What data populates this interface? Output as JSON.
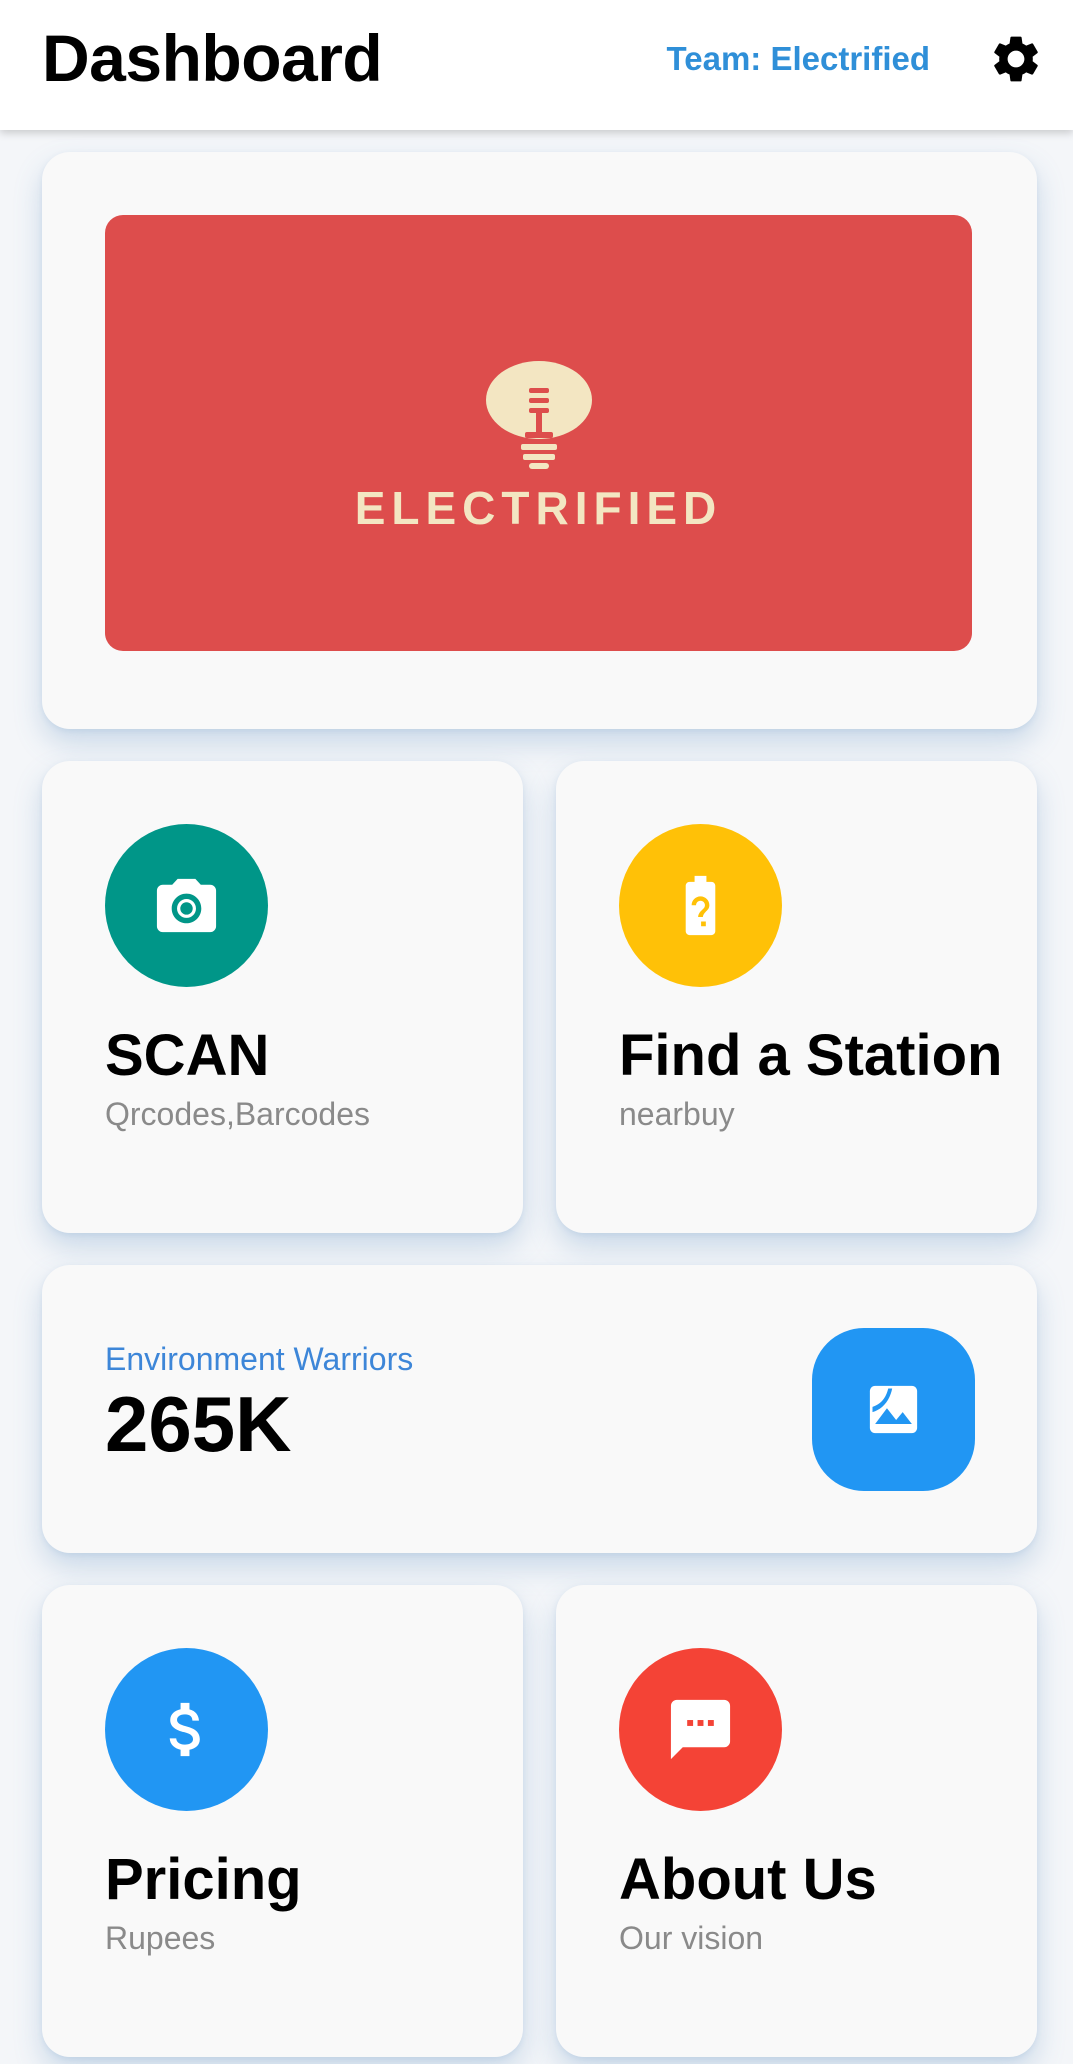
{
  "appbar": {
    "title": "Dashboard",
    "team_label": "Team: Electrified",
    "settings_icon": "gear-icon"
  },
  "banner": {
    "brand": "ELECTRIFIED",
    "background_color": "#dd4d4c",
    "foreground_color": "#f3e6c2",
    "icon": "lightbulb-icon"
  },
  "tiles": [
    {
      "label": "SCAN",
      "sub": "Qrcodes,Barcodes",
      "icon": "camera-icon",
      "color": "#009688"
    },
    {
      "label": "Find a Station",
      "sub": "nearbuy",
      "icon": "battery-unknown-icon",
      "color": "#ffc107"
    },
    {
      "label": "Pricing",
      "sub": "Rupees",
      "icon": "dollar-icon",
      "color": "#2196f3"
    },
    {
      "label": "About Us",
      "sub": "Our vision",
      "icon": "message-icon",
      "color": "#f44336"
    }
  ],
  "stat": {
    "label": "Environment Warriors",
    "value": "265K",
    "icon": "image-icon",
    "color": "#2196f3"
  }
}
